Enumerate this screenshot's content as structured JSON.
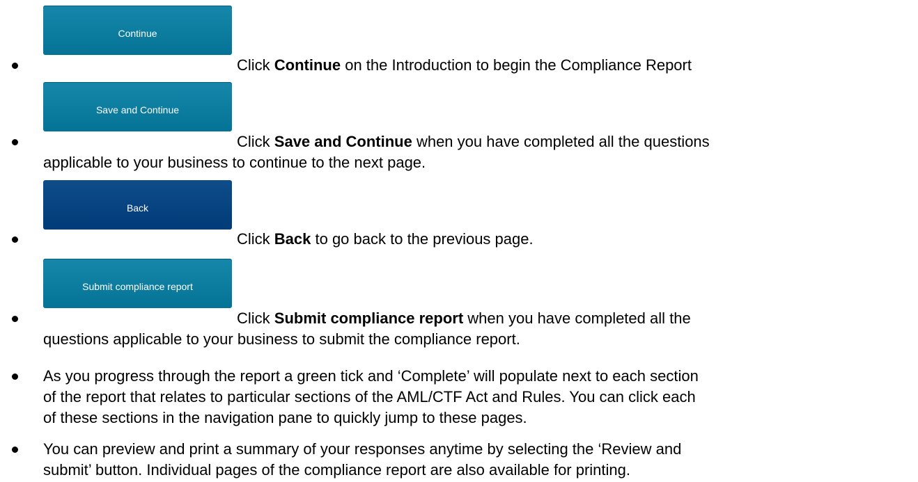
{
  "items": [
    {
      "button_label": "Continue",
      "text_prefix": "Click ",
      "text_bold": "Continue",
      "text_line1": " on the Introduction to begin the Compliance Report",
      "text_line2": ""
    },
    {
      "button_label": "Save and Continue",
      "text_prefix": "Click ",
      "text_bold": "Save and Continue",
      "text_line1": " when you have completed all the questions",
      "text_line2": "applicable to your business to continue to the next page."
    },
    {
      "button_label": "Back",
      "text_prefix": "Click ",
      "text_bold": "Back",
      "text_line1": " to go back to the previous page.",
      "text_line2": ""
    },
    {
      "button_label": "Submit compliance report",
      "text_prefix": "Click ",
      "text_bold": "Submit compliance report",
      "text_line1": " when you have completed all the",
      "text_line2": "questions applicable to your business to submit the compliance report."
    }
  ],
  "paragraphs": [
    {
      "lines": [
        "As you progress through the report a green tick and ‘Complete’ will populate next to each section",
        "of the report that relates to particular sections of the AML/CTF Act and Rules. You can click each",
        "of these sections in the navigation pane to quickly jump to these pages."
      ]
    },
    {
      "lines": [
        "You can preview and print a summary of your responses anytime by selecting the ‘Review and",
        "submit’ button. Individual pages of the compliance report are also available for printing."
      ]
    }
  ],
  "colors": {
    "teal_button": "#047396",
    "navy_button": "#013b78"
  }
}
